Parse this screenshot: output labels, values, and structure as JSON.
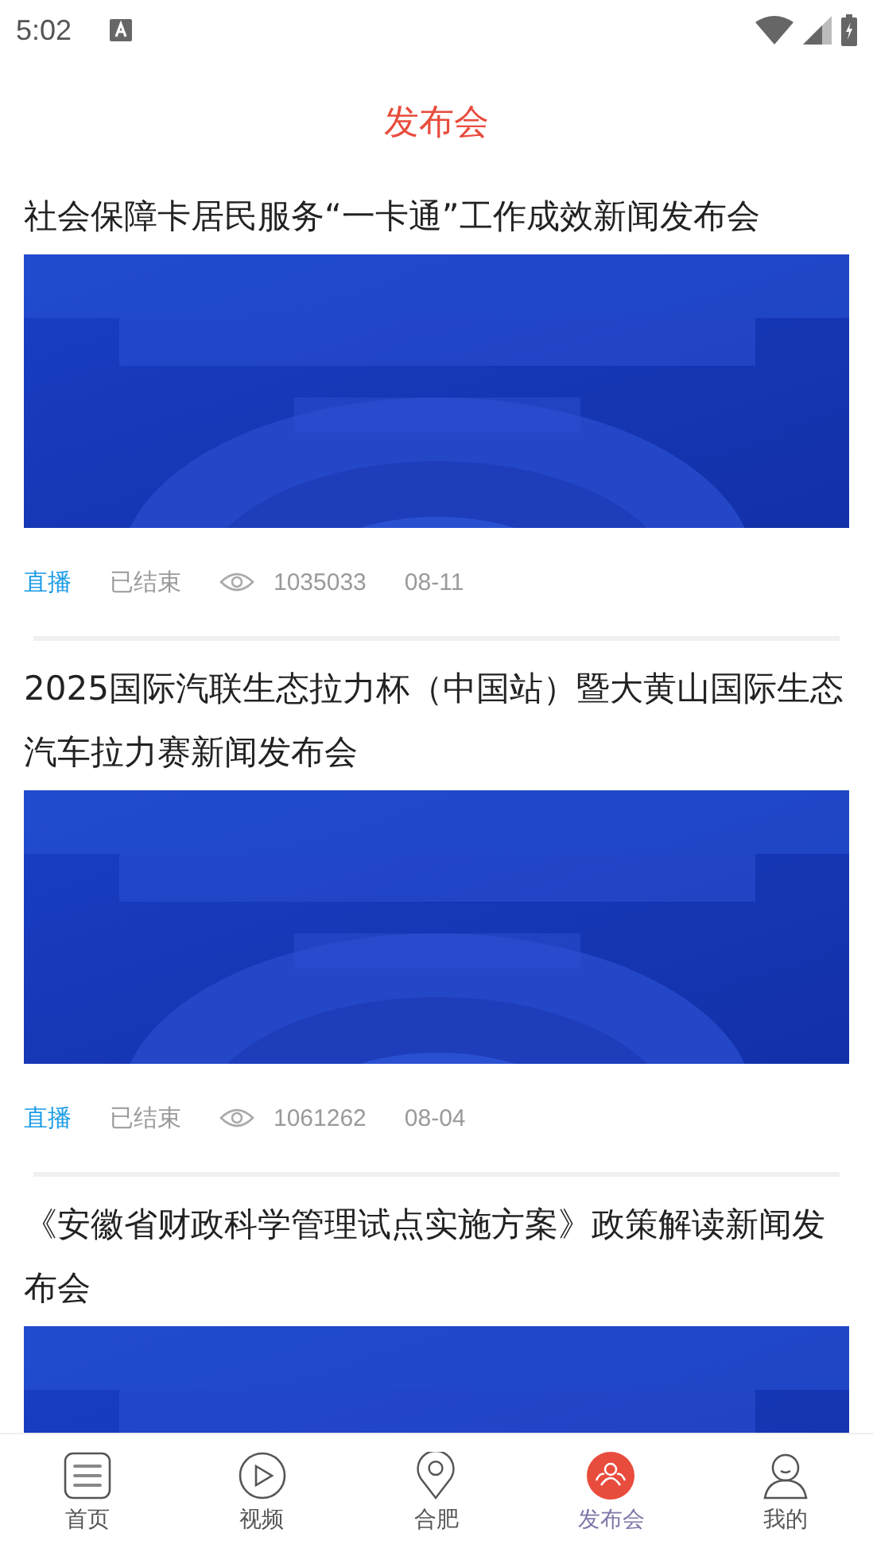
{
  "status_bar": {
    "time": "5:02"
  },
  "header": {
    "title": "发布会"
  },
  "items": [
    {
      "title": "社会保障卡居民服务“一卡通”工作成效新闻发布会",
      "tag": "直播",
      "status": "已结束",
      "views": "1035033",
      "date": "08-11"
    },
    {
      "title": "2025国际汽联生态拉力杯（中国站）暨大黄山国际生态汽车拉力赛新闻发布会",
      "tag": "直播",
      "status": "已结束",
      "views": "1061262",
      "date": "08-04"
    },
    {
      "title": "《安徽省财政科学管理试点实施方案》政策解读新闻发布会"
    }
  ],
  "tab_bar": [
    {
      "label": "首页",
      "kind": "news",
      "selected": false
    },
    {
      "label": "视频",
      "kind": "video",
      "selected": false
    },
    {
      "label": "合肥",
      "kind": "location",
      "selected": false
    },
    {
      "label": "发布会",
      "kind": "conference",
      "selected": true
    },
    {
      "label": "我的",
      "kind": "profile",
      "selected": false
    }
  ]
}
